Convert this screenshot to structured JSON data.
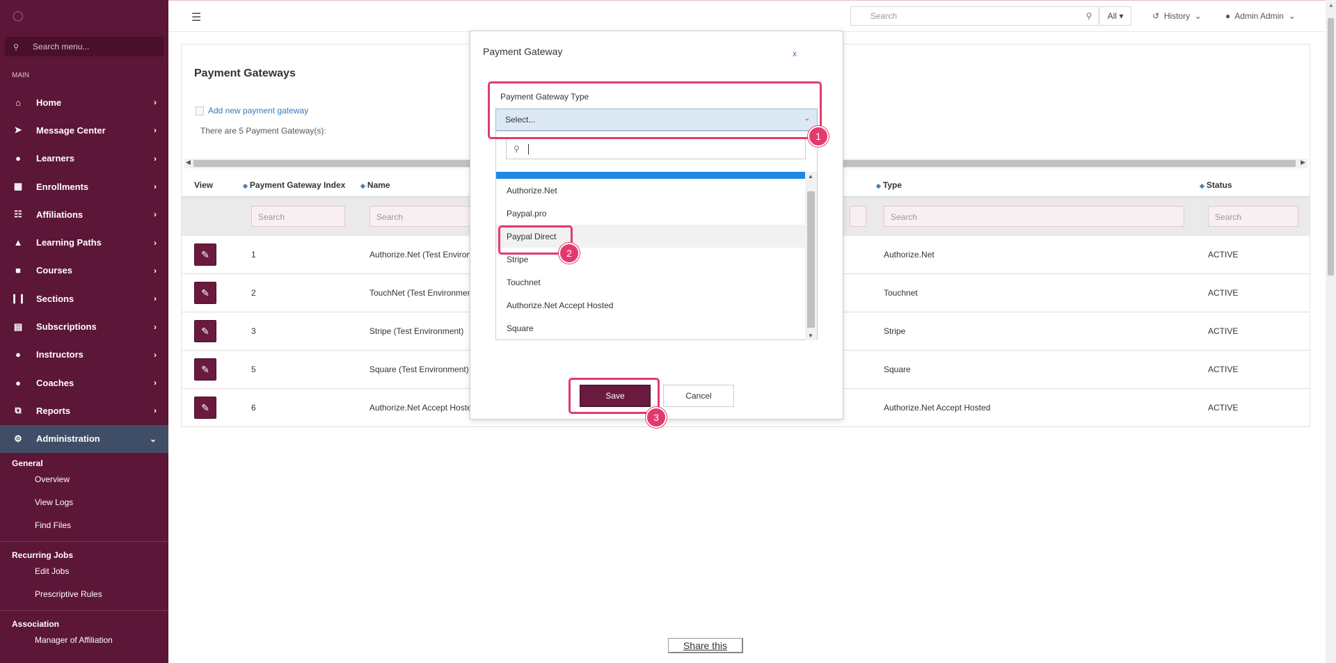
{
  "sidebar": {
    "search_placeholder": "Search menu...",
    "section_main": "MAIN",
    "items": [
      {
        "label": "Home",
        "icon": "home-icon"
      },
      {
        "label": "Message Center",
        "icon": "paper-plane-icon"
      },
      {
        "label": "Learners",
        "icon": "learner-icon"
      },
      {
        "label": "Enrollments",
        "icon": "calendar-icon"
      },
      {
        "label": "Affiliations",
        "icon": "sitemap-icon"
      },
      {
        "label": "Learning Paths",
        "icon": "graduation-cap-icon"
      },
      {
        "label": "Courses",
        "icon": "book-icon"
      },
      {
        "label": "Sections",
        "icon": "library-icon"
      },
      {
        "label": "Subscriptions",
        "icon": "list-icon"
      },
      {
        "label": "Instructors",
        "icon": "instructor-icon"
      },
      {
        "label": "Coaches",
        "icon": "coach-icon"
      },
      {
        "label": "Reports",
        "icon": "copy-icon"
      },
      {
        "label": "Administration",
        "icon": "gear-icon"
      }
    ],
    "groups": [
      {
        "title": "General",
        "items": [
          "Overview",
          "View Logs",
          "Find Files"
        ]
      },
      {
        "title": "Recurring Jobs",
        "items": [
          "Edit Jobs",
          "Prescriptive Rules"
        ]
      },
      {
        "title": "Association",
        "items": [
          "Manager of Affiliation"
        ]
      }
    ]
  },
  "topbar": {
    "search_placeholder": "Search",
    "filter": "All",
    "history": "History",
    "user": "Admin Admin"
  },
  "panel": {
    "title": "Payment Gateways",
    "add_link": "Add new payment gateway",
    "count_text": "There are 5 Payment Gateway(s):",
    "columns": [
      "View",
      "Payment Gateway Index",
      "Name",
      "Type",
      "Status"
    ],
    "filter_placeholder": "Search",
    "rows": [
      {
        "index": "1",
        "name": "Authorize.Net (Test Environn",
        "type": "Authorize.Net",
        "status": "ACTIVE"
      },
      {
        "index": "2",
        "name": "TouchNet (Test Environment",
        "type": "Touchnet",
        "status": "ACTIVE"
      },
      {
        "index": "3",
        "name": "Stripe (Test Environment)",
        "type": "Stripe",
        "status": "ACTIVE"
      },
      {
        "index": "5",
        "name": "Square (Test Environment)",
        "type": "Square",
        "status": "ACTIVE"
      },
      {
        "index": "6",
        "name": "Authorize.Net Accept Hoste",
        "type": "Authorize.Net Accept Hosted",
        "status": "ACTIVE"
      }
    ]
  },
  "modal": {
    "title": "Payment Gateway",
    "close": "x",
    "field_label": "Payment Gateway Type",
    "select_value": "Select...",
    "options": [
      "Authorize.Net",
      "Paypal.pro",
      "Paypal Direct",
      "Stripe",
      "Touchnet",
      "Authorize.Net Accept Hosted",
      "Square"
    ],
    "save": "Save",
    "cancel": "Cancel"
  },
  "annotations": {
    "step1": "1",
    "step2": "2",
    "step3": "3"
  },
  "share": "Share this",
  "colors": {
    "sidebar": "#5c1637",
    "accent": "#6a1a3f",
    "highlight": "#e33a6d",
    "active_item": "#3f4e66"
  }
}
